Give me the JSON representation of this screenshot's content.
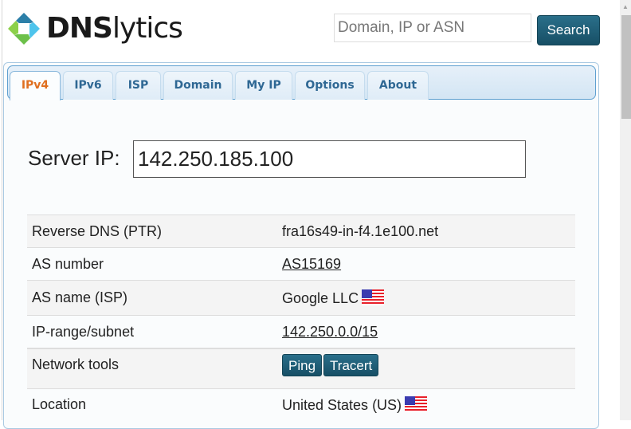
{
  "header": {
    "logo": {
      "bold": "DNS",
      "rest": "lytics"
    },
    "search": {
      "placeholder": "Domain, IP or ASN",
      "value": "",
      "button_label": "Search"
    }
  },
  "tabs": [
    {
      "label": "IPv4",
      "active": true
    },
    {
      "label": "IPv6",
      "active": false
    },
    {
      "label": "ISP",
      "active": false
    },
    {
      "label": "Domain",
      "active": false
    },
    {
      "label": "My IP",
      "active": false
    },
    {
      "label": "Options",
      "active": false
    },
    {
      "label": "About",
      "active": false
    }
  ],
  "server": {
    "label": "Server IP:",
    "value": "142.250.185.100"
  },
  "info": {
    "reverse_dns": {
      "label": "Reverse DNS (PTR)",
      "value": "fra16s49-in-f4.1e100.net"
    },
    "as_number": {
      "label": "AS number",
      "value": "AS15169"
    },
    "as_name": {
      "label": "AS name (ISP)",
      "value": "Google LLC",
      "flag": "us-flag-icon"
    },
    "ip_range": {
      "label": "IP-range/subnet",
      "value": "142.250.0.0/15"
    },
    "network_tools": {
      "label": "Network tools",
      "buttons": [
        "Ping",
        "Tracert"
      ]
    },
    "location": {
      "label": "Location",
      "value": "United States (US)",
      "flag": "us-flag-icon"
    }
  },
  "colors": {
    "accent_button": "#1d5a72",
    "active_tab": "#e07020",
    "tab_text": "#2f6894"
  }
}
